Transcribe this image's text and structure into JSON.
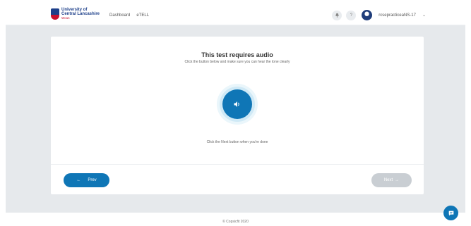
{
  "header": {
    "logo": {
      "line1": "University of",
      "line2": "Central Lancashire",
      "line3": "Wcan"
    },
    "nav": [
      "Dashboard",
      "eTELL"
    ],
    "tools": {
      "notifications_icon": "bell-icon",
      "help_label": "?",
      "username": "rcsepracticeaNS-17"
    }
  },
  "test": {
    "title": "This test requires audio",
    "subtitle": "Click the button below and make sure you can hear the tone clearly",
    "audio_icon": "speaker-icon",
    "hint": "Click the Next button when you're done"
  },
  "navigation": {
    "prev_label": "Prev",
    "prev_arrow": "←",
    "next_label": "Next",
    "next_arrow": "→"
  },
  "footer": {
    "text": "© Copsicfit 2020"
  },
  "colors": {
    "accent": "#0f76b6",
    "disabled": "#c9ced3",
    "background": "#e6e9ec"
  }
}
